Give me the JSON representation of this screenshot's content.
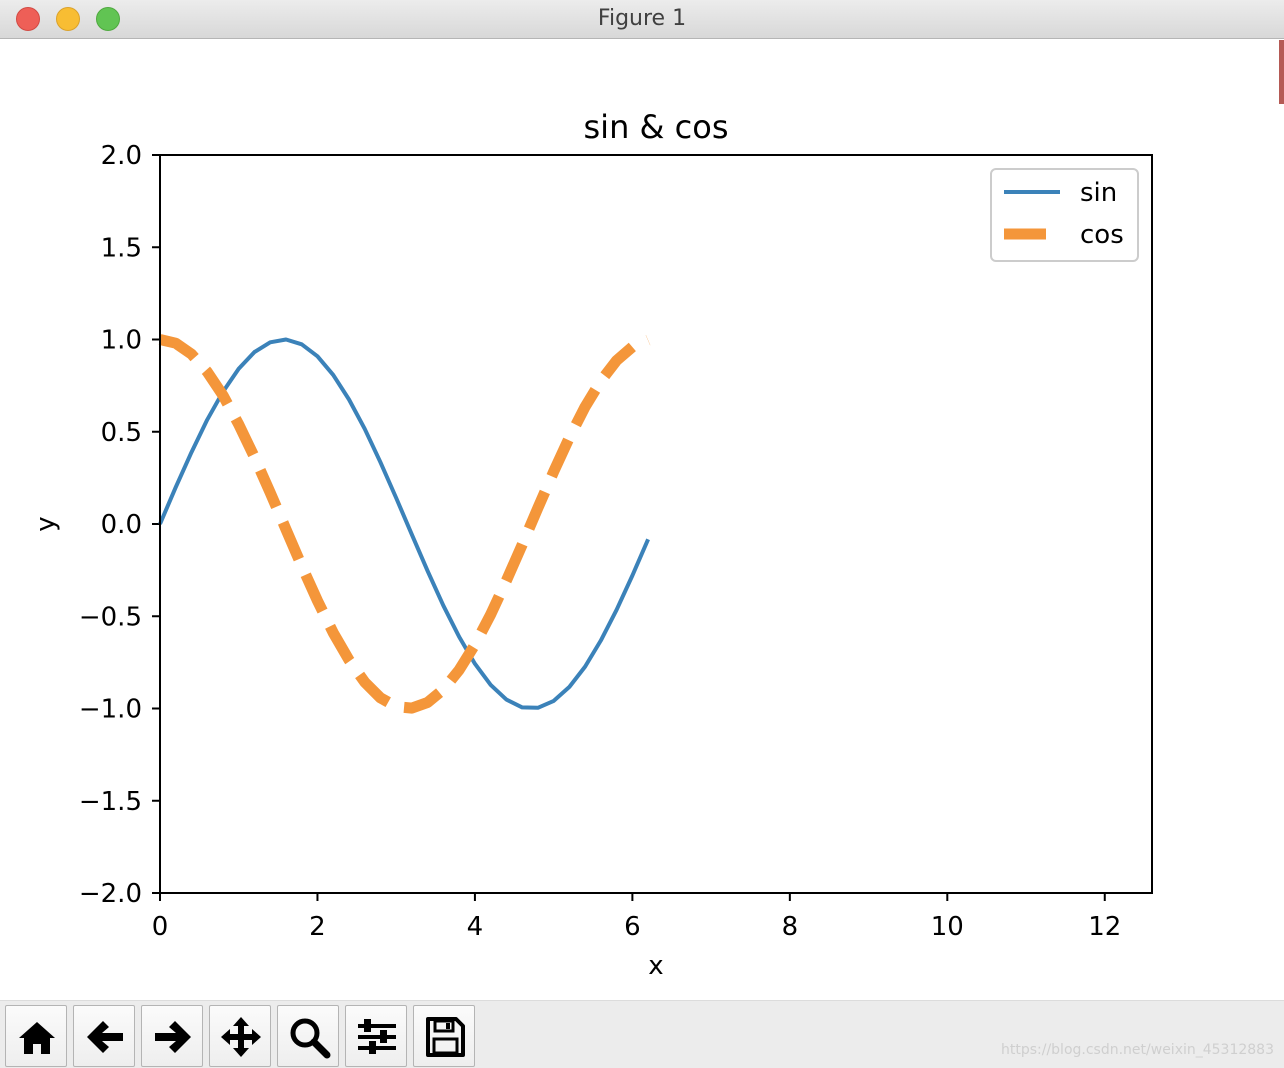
{
  "window": {
    "title": "Figure 1"
  },
  "toolbar": {
    "buttons": [
      {
        "icon": "home-icon"
      },
      {
        "icon": "arrow-left-icon"
      },
      {
        "icon": "arrow-right-icon"
      },
      {
        "icon": "move-icon"
      },
      {
        "icon": "zoom-icon"
      },
      {
        "icon": "sliders-icon"
      },
      {
        "icon": "save-icon"
      }
    ]
  },
  "watermark": "https://blog.csdn.net/weixin_45312883",
  "colors": {
    "sin": "#3b82b9",
    "cos": "#f4963a"
  },
  "chart_data": {
    "type": "line",
    "title": "sin & cos",
    "xlabel": "x",
    "ylabel": "y",
    "xlim": [
      0,
      12.6
    ],
    "ylim": [
      -2.0,
      2.0
    ],
    "xticks": [
      0,
      2,
      4,
      6,
      8,
      10,
      12
    ],
    "xtick_labels": [
      "0",
      "2",
      "4",
      "6",
      "8",
      "10",
      "12"
    ],
    "yticks": [
      2.0,
      1.5,
      1.0,
      0.5,
      0.0,
      -0.5,
      -1.0,
      -1.5,
      -2.0
    ],
    "ytick_labels": [
      "2.0",
      "1.5",
      "1.0",
      "0.5",
      "0.0",
      "−0.5",
      "−1.0",
      "−1.5",
      "−2.0"
    ],
    "legend_position": "upper right",
    "grid": false,
    "series": [
      {
        "name": "sin",
        "style": "solid",
        "x": [
          0,
          0.2,
          0.4,
          0.6,
          0.8,
          1.0,
          1.2,
          1.4,
          1.6,
          1.8,
          2.0,
          2.2,
          2.4,
          2.6,
          2.8,
          3.0,
          3.2,
          3.4,
          3.6,
          3.8,
          4.0,
          4.2,
          4.4,
          4.6,
          4.8,
          5.0,
          5.2,
          5.4,
          5.6,
          5.8,
          6.0,
          6.2
        ],
        "y": [
          0.0,
          0.199,
          0.389,
          0.565,
          0.717,
          0.841,
          0.932,
          0.985,
          1.0,
          0.974,
          0.909,
          0.808,
          0.675,
          0.516,
          0.335,
          0.141,
          -0.058,
          -0.256,
          -0.443,
          -0.612,
          -0.757,
          -0.872,
          -0.952,
          -0.994,
          -0.996,
          -0.959,
          -0.883,
          -0.773,
          -0.631,
          -0.465,
          -0.279,
          -0.083
        ]
      },
      {
        "name": "cos",
        "style": "dashed",
        "x": [
          0,
          0.2,
          0.4,
          0.6,
          0.8,
          1.0,
          1.2,
          1.4,
          1.6,
          1.8,
          2.0,
          2.2,
          2.4,
          2.6,
          2.8,
          3.0,
          3.2,
          3.4,
          3.6,
          3.8,
          4.0,
          4.2,
          4.4,
          4.6,
          4.8,
          5.0,
          5.2,
          5.4,
          5.6,
          5.8,
          6.0,
          6.2
        ],
        "y": [
          1.0,
          0.98,
          0.921,
          0.825,
          0.697,
          0.54,
          0.362,
          0.17,
          -0.029,
          -0.227,
          -0.416,
          -0.589,
          -0.737,
          -0.857,
          -0.942,
          -0.99,
          -0.998,
          -0.967,
          -0.897,
          -0.791,
          -0.654,
          -0.49,
          -0.307,
          -0.112,
          0.087,
          0.284,
          0.469,
          0.635,
          0.776,
          0.886,
          0.96,
          0.997
        ]
      }
    ]
  }
}
